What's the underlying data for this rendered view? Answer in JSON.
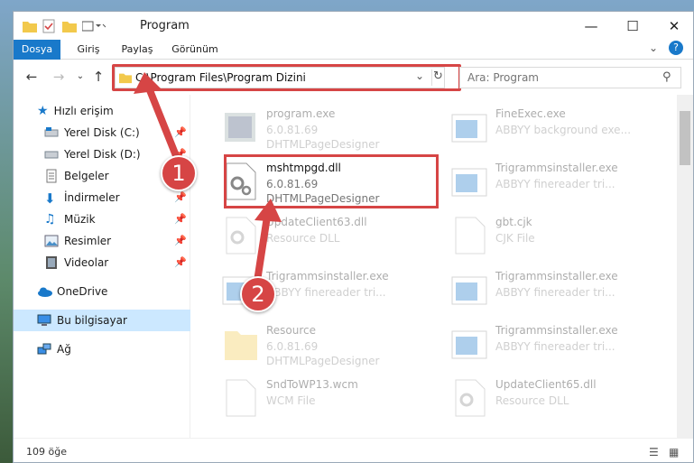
{
  "window": {
    "title": "Program"
  },
  "ribbon": {
    "tabs": [
      "Dosya",
      "Giriş",
      "Paylaş",
      "Görünüm"
    ]
  },
  "address": {
    "path": "C:\\Program Files\\Program Dizini"
  },
  "search": {
    "placeholder": "Ara: Program"
  },
  "sidebar": {
    "items": [
      {
        "label": "Hızlı erişim",
        "icon": "star-icon"
      },
      {
        "label": "Yerel Disk (C:)",
        "icon": "drive-icon",
        "pinned": true
      },
      {
        "label": "Yerel Disk (D:)",
        "icon": "drive-icon",
        "pinned": true
      },
      {
        "label": "Belgeler",
        "icon": "documents-icon",
        "pinned": true
      },
      {
        "label": "İndirmeler",
        "icon": "download-icon",
        "pinned": true
      },
      {
        "label": "Müzik",
        "icon": "music-icon",
        "pinned": true
      },
      {
        "label": "Resimler",
        "icon": "pictures-icon",
        "pinned": true
      },
      {
        "label": "Videolar",
        "icon": "videos-icon",
        "pinned": true
      },
      {
        "label": "OneDrive",
        "icon": "cloud-icon"
      },
      {
        "label": "Bu bilgisayar",
        "icon": "computer-icon",
        "selected": true
      },
      {
        "label": "Ağ",
        "icon": "network-icon"
      }
    ]
  },
  "files": [
    {
      "name": "program.exe",
      "l2": "6.0.81.69",
      "l3": "DHTMLPageDesigner",
      "faded": true
    },
    {
      "name": "FineExec.exe",
      "l2": "ABBYY background exe...",
      "l3": "",
      "faded": true
    },
    {
      "name": "mshtmpgd.dll",
      "l2": "6.0.81.69",
      "l3": "DHTMLPageDesigner",
      "faded": false
    },
    {
      "name": "Trigrammsinstaller.exe",
      "l2": "ABBYY finereader tri...",
      "l3": "",
      "faded": true
    },
    {
      "name": "UpdateClient63.dll",
      "l2": "Resource DLL",
      "l3": "",
      "faded": true
    },
    {
      "name": "gbt.cjk",
      "l2": "CJK File",
      "l3": "",
      "faded": true
    },
    {
      "name": "Trigrammsinstaller.exe",
      "l2": "ABBYY finereader tri...",
      "l3": "",
      "faded": true
    },
    {
      "name": "Trigrammsinstaller.exe",
      "l2": "ABBYY finereader tri...",
      "l3": "",
      "faded": true
    },
    {
      "name": "Resource",
      "l2": "6.0.81.69",
      "l3": "DHTMLPageDesigner",
      "faded": true
    },
    {
      "name": "Trigrammsinstaller.exe",
      "l2": "ABBYY finereader tri...",
      "l3": "",
      "faded": true
    },
    {
      "name": "SndToWP13.wcm",
      "l2": "WCM File",
      "l3": "",
      "faded": true
    },
    {
      "name": "UpdateClient65.dll",
      "l2": "Resource DLL",
      "l3": "",
      "faded": true
    }
  ],
  "status": {
    "count": "109 öğe"
  },
  "callouts": {
    "one": "1",
    "two": "2"
  },
  "colors": {
    "accent": "#1979ca",
    "highlight": "#d64545",
    "selected": "#cce8ff"
  }
}
